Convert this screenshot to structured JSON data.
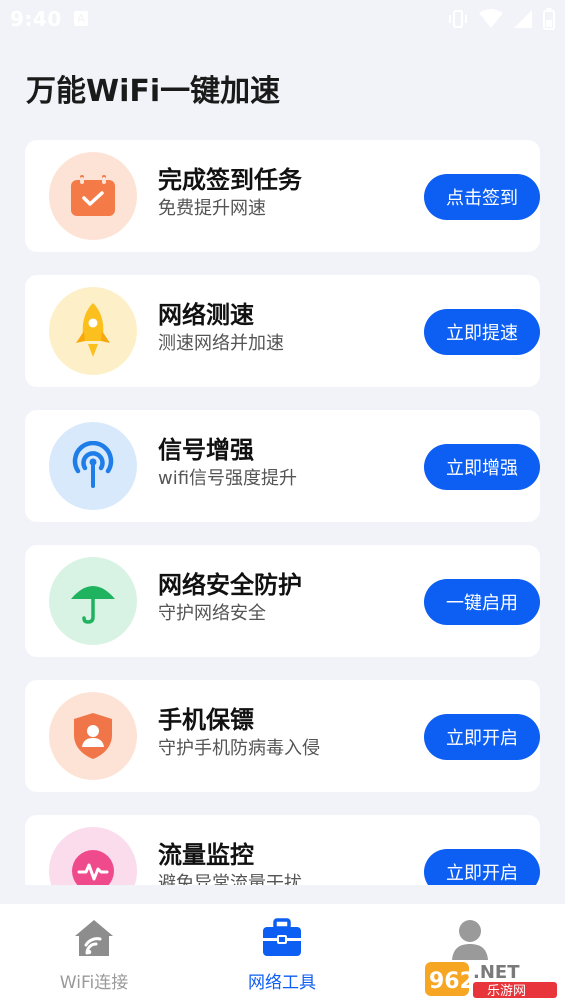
{
  "status": {
    "time": "9:40",
    "a_label": "A"
  },
  "header": {
    "title": "万能WiFi一键加速"
  },
  "features": [
    {
      "title": "完成签到任务",
      "subtitle": "免费提升网速",
      "button": "点击签到",
      "icon": "calendar-check-icon",
      "icon_bg": "#fde3d5",
      "icon_color": "#f47a48"
    },
    {
      "title": "网络测速",
      "subtitle": "测速网络并加速",
      "button": "立即提速",
      "icon": "rocket-icon",
      "icon_bg": "#fdf0c9",
      "icon_color": "#fbbf1e"
    },
    {
      "title": "信号增强",
      "subtitle": "wifi信号强度提升",
      "button": "立即增强",
      "icon": "signal-antenna-icon",
      "icon_bg": "#d8e9fc",
      "icon_color": "#1f7de8"
    },
    {
      "title": "网络安全防护",
      "subtitle": "守护网络安全",
      "button": "一键启用",
      "icon": "umbrella-icon",
      "icon_bg": "#d8f3e3",
      "icon_color": "#1fb35f"
    },
    {
      "title": "手机保镖",
      "subtitle": "守护手机防病毒入侵",
      "button": "立即开启",
      "icon": "shield-user-icon",
      "icon_bg": "#fde3d5",
      "icon_color": "#f0764a"
    },
    {
      "title": "流量监控",
      "subtitle": "避免异常流量干扰",
      "button": "立即开启",
      "icon": "traffic-pulse-icon",
      "icon_bg": "#fbdcec",
      "icon_color": "#ef4a8c"
    }
  ],
  "tabs": [
    {
      "label": "WiFi连接",
      "icon": "home-wifi-icon",
      "active": false
    },
    {
      "label": "网络工具",
      "icon": "toolbox-icon",
      "active": true
    },
    {
      "label": "",
      "icon": "user-icon",
      "active": false
    }
  ],
  "watermark": {
    "text": "962.NET",
    "subtext": "乐游网"
  },
  "colors": {
    "accent": "#0d5ef2",
    "background": "#f2f3f8"
  }
}
